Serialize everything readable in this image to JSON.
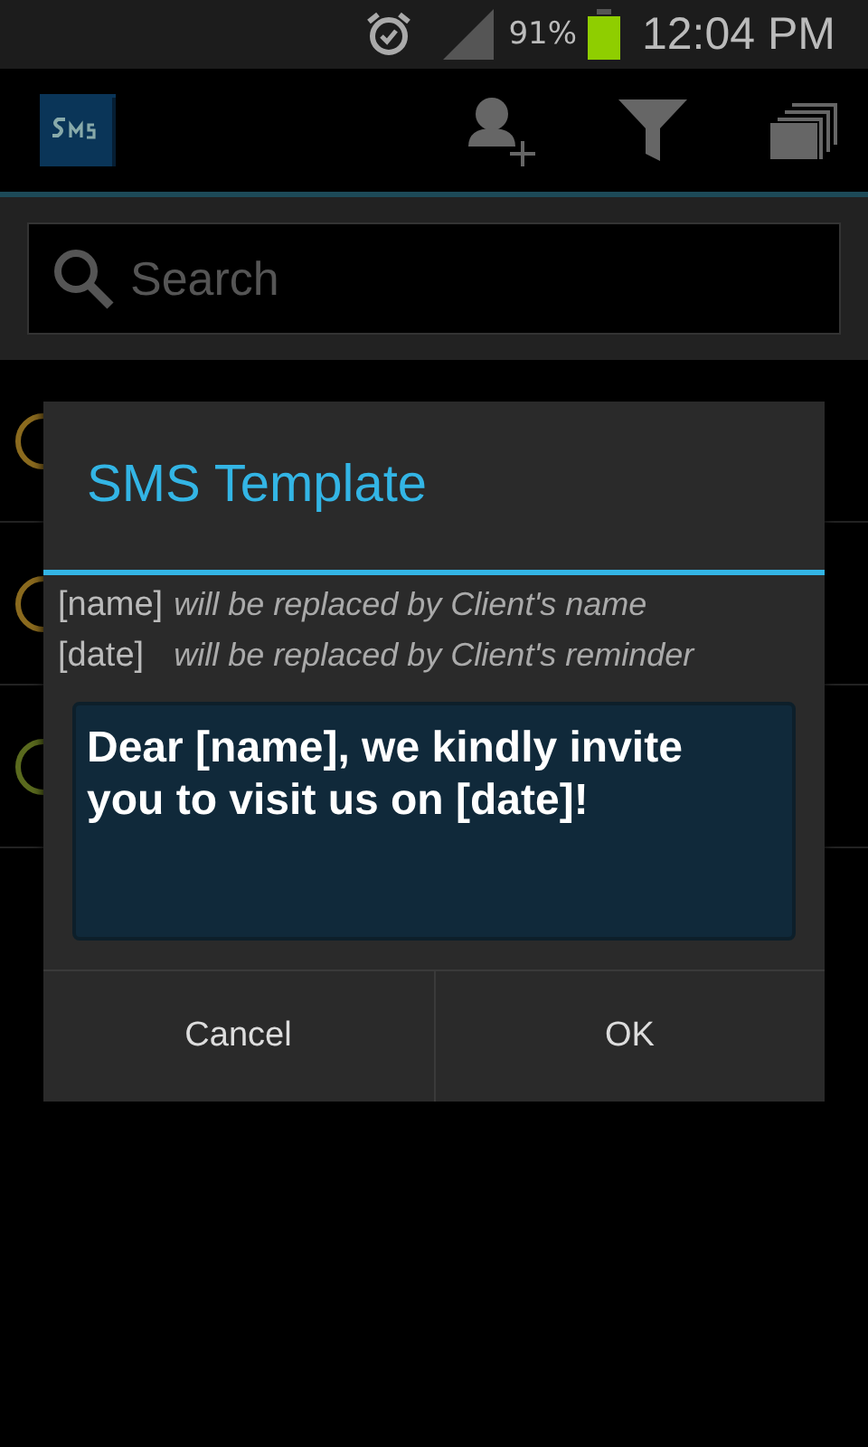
{
  "status_bar": {
    "battery": "91%",
    "time": "12:04 PM"
  },
  "search": {
    "placeholder": "Search"
  },
  "list": {
    "rows": [
      {
        "color": "#8a6a1e"
      },
      {
        "color": "#8a6a1e"
      },
      {
        "color": "#5a6a1e"
      }
    ]
  },
  "dialog": {
    "title": "SMS Template",
    "hints": [
      {
        "token": "[name]",
        "text": "will be replaced by Client's name"
      },
      {
        "token": "[date]",
        "text": "will be replaced by Client's reminder"
      }
    ],
    "template": "Dear [name], we kindly invite you to visit us on [date]!",
    "buttons": [
      "Cancel",
      "OK"
    ]
  }
}
